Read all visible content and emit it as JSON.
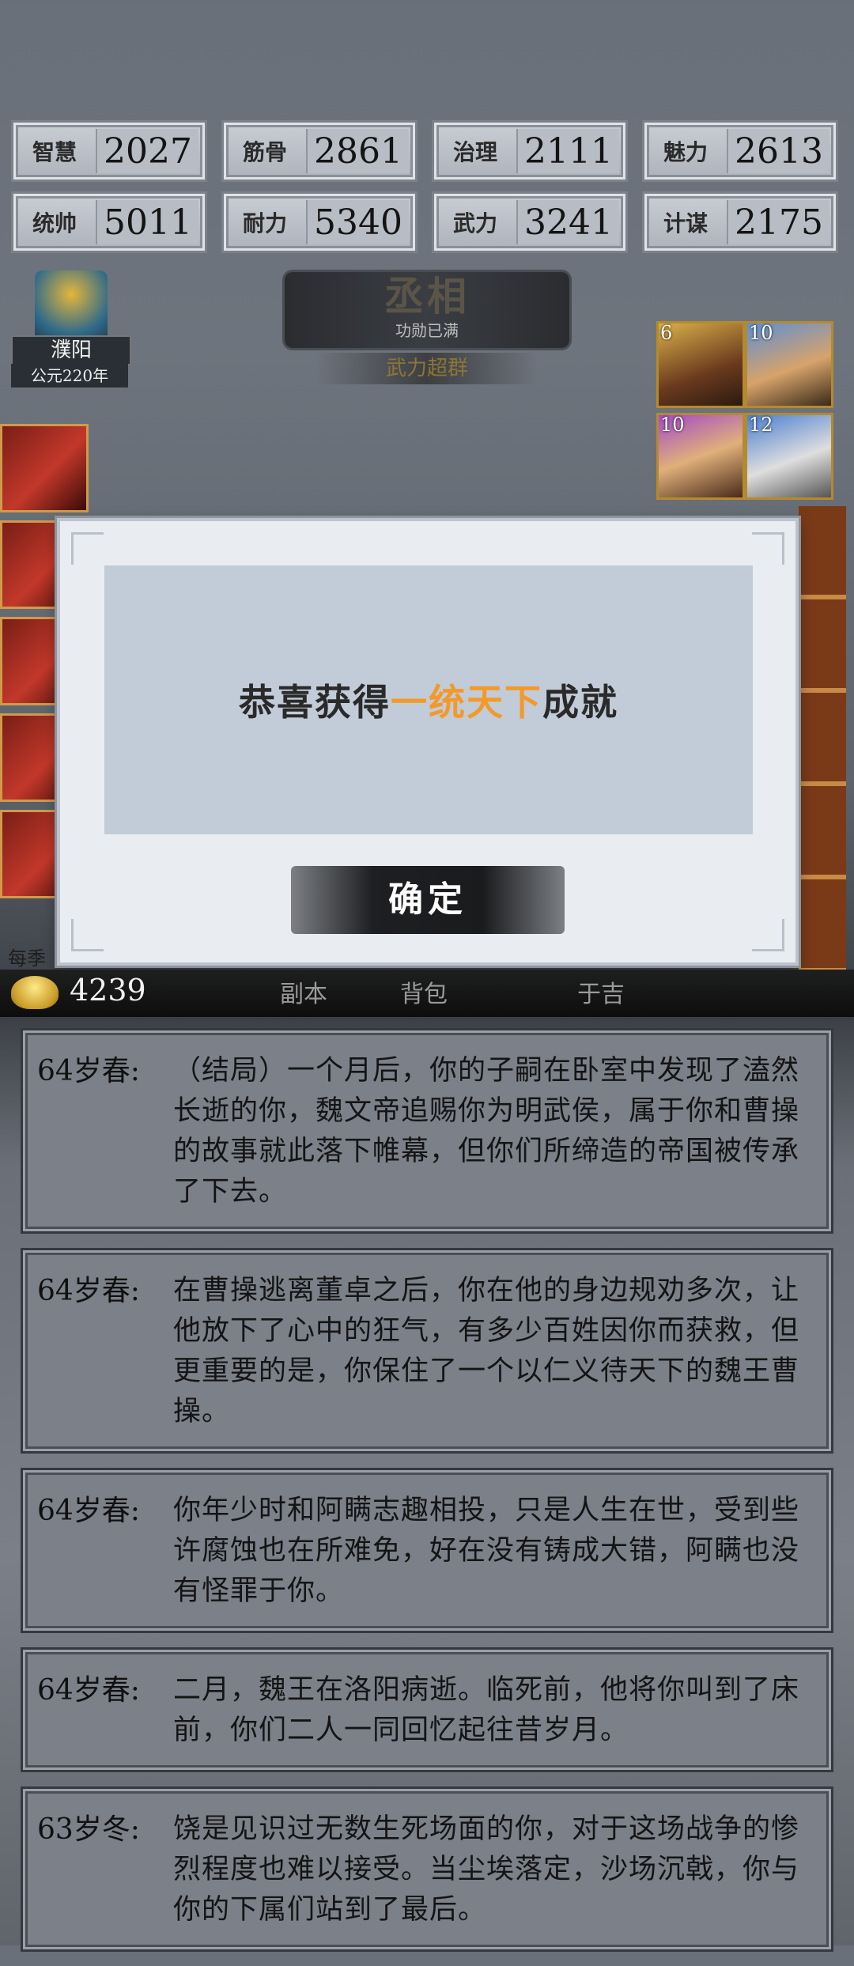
{
  "stats": [
    [
      {
        "label": "智慧",
        "value": "2027"
      },
      {
        "label": "筋骨",
        "value": "2861"
      },
      {
        "label": "治理",
        "value": "2111"
      },
      {
        "label": "魅力",
        "value": "2613"
      }
    ],
    [
      {
        "label": "统帅",
        "value": "5011"
      },
      {
        "label": "耐力",
        "value": "5340"
      },
      {
        "label": "武力",
        "value": "3241"
      },
      {
        "label": "计谋",
        "value": "2175"
      }
    ]
  ],
  "location": {
    "place": "濮阳",
    "year": "公元220年"
  },
  "title": {
    "rank": "丞相",
    "status": "功勋已满",
    "trait": "武力超群"
  },
  "portraits": [
    {
      "level": "6"
    },
    {
      "level": "10"
    },
    {
      "level": "10"
    },
    {
      "level": "12"
    }
  ],
  "side_label": "每季",
  "modal": {
    "prefix": "恭喜获得",
    "highlight": "一统天下",
    "suffix": "成就",
    "confirm_label": "确定",
    "highlight_color": "#f19a2a"
  },
  "bottom_bar": {
    "gold": "4239",
    "tabs": [
      "副本",
      "背包",
      "于吉"
    ]
  },
  "log": [
    {
      "age": "64岁春:",
      "text": "（结局）一个月后，你的子嗣在卧室中发现了溘然长逝的你，魏文帝追赐你为明武侯，属于你和曹操的故事就此落下帷幕，但你们所缔造的帝国被传承了下去。"
    },
    {
      "age": "64岁春:",
      "text": "在曹操逃离董卓之后，你在他的身边规劝多次，让他放下了心中的狂气，有多少百姓因你而获救，但更重要的是，你保住了一个以仁义待天下的魏王曹操。"
    },
    {
      "age": "64岁春:",
      "text": "你年少时和阿瞒志趣相投，只是人生在世，受到些许腐蚀也在所难免，好在没有铸成大错，阿瞒也没有怪罪于你。"
    },
    {
      "age": "64岁春:",
      "text": "二月，魏王在洛阳病逝。临死前，他将你叫到了床前，你们二人一同回忆起往昔岁月。"
    },
    {
      "age": "63岁冬:",
      "text": "饶是见识过无数生死场面的你，对于这场战争的惨烈程度也难以接受。当尘埃落定，沙场沉戟，你与你的下属们站到了最后。"
    }
  ]
}
